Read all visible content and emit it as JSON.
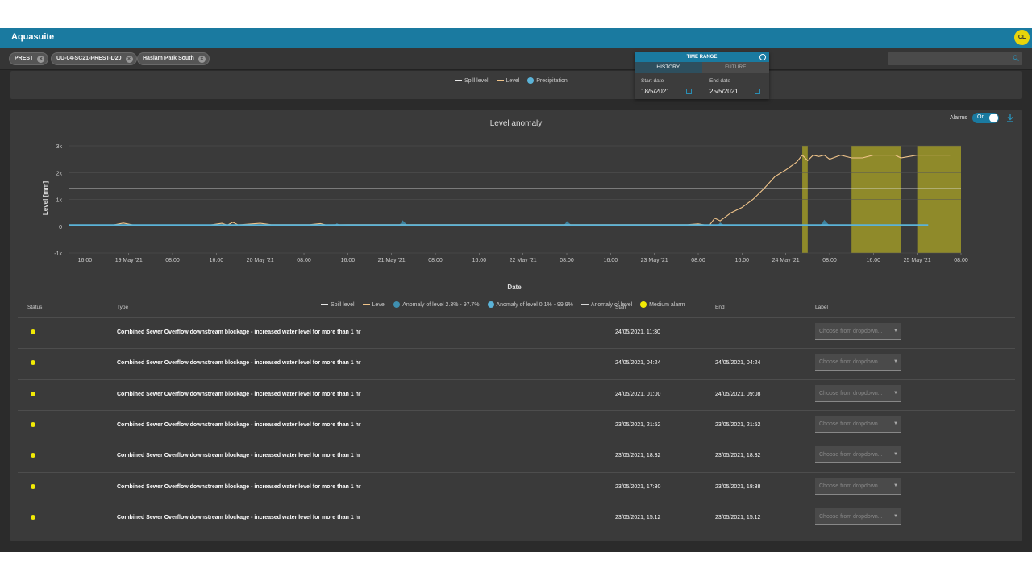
{
  "app": {
    "title": "Aquasuite",
    "avatar": "CL"
  },
  "filters": [
    {
      "label": "PREST",
      "remove": "×"
    },
    {
      "label": "UU-04-SC21-PREST-D20",
      "remove": "×"
    },
    {
      "label": "Haslam Park South",
      "remove": "×"
    }
  ],
  "search": {
    "placeholder": "",
    "icon": "search-icon"
  },
  "top_legend": [
    {
      "label": "Spill level",
      "color": "#e8e8e8",
      "kind": "line"
    },
    {
      "label": "Level",
      "color": "#f0c48a",
      "kind": "line"
    },
    {
      "label": "Precipitation",
      "color": "#5bb3d8",
      "kind": "dot"
    }
  ],
  "time_range": {
    "title": "TIME RANGE",
    "tabs": [
      "HISTORY",
      "FUTURE"
    ],
    "active_tab": "HISTORY",
    "start_label": "Start date",
    "start_value": "18/5/2021",
    "end_label": "End date",
    "end_value": "25/5/2021"
  },
  "alarms": {
    "label": "Alarms",
    "toggle_text": "On",
    "enabled": true
  },
  "chart_data": {
    "type": "line",
    "title": "Level anomaly",
    "xlabel": "Date",
    "ylabel": "Level [mm]",
    "ylim": [
      -1000,
      3000
    ],
    "yticks": [
      "3k",
      "2k",
      "1k",
      "0",
      "-1k"
    ],
    "xlim": [
      "2021-05-18 13:00",
      "2021-05-25 08:00"
    ],
    "xticks": [
      {
        "t": "2021-05-18 16:00",
        "label": "16:00"
      },
      {
        "t": "2021-05-19 00:00",
        "label": "19 May '21"
      },
      {
        "t": "2021-05-19 08:00",
        "label": "08:00"
      },
      {
        "t": "2021-05-19 16:00",
        "label": "16:00"
      },
      {
        "t": "2021-05-20 00:00",
        "label": "20 May '21"
      },
      {
        "t": "2021-05-20 08:00",
        "label": "08:00"
      },
      {
        "t": "2021-05-20 16:00",
        "label": "16:00"
      },
      {
        "t": "2021-05-21 00:00",
        "label": "21 May '21"
      },
      {
        "t": "2021-05-21 08:00",
        "label": "08:00"
      },
      {
        "t": "2021-05-21 16:00",
        "label": "16:00"
      },
      {
        "t": "2021-05-22 00:00",
        "label": "22 May '21"
      },
      {
        "t": "2021-05-22 08:00",
        "label": "08:00"
      },
      {
        "t": "2021-05-22 16:00",
        "label": "16:00"
      },
      {
        "t": "2021-05-23 00:00",
        "label": "23 May '21"
      },
      {
        "t": "2021-05-23 08:00",
        "label": "08:00"
      },
      {
        "t": "2021-05-23 16:00",
        "label": "16:00"
      },
      {
        "t": "2021-05-24 00:00",
        "label": "24 May '21"
      },
      {
        "t": "2021-05-24 08:00",
        "label": "08:00"
      },
      {
        "t": "2021-05-24 16:00",
        "label": "16:00"
      },
      {
        "t": "2021-05-25 00:00",
        "label": "25 May '21"
      },
      {
        "t": "2021-05-25 08:00",
        "label": "08:00"
      }
    ],
    "series": [
      {
        "name": "Spill level",
        "color": "#e8e8e8",
        "points": [
          [
            "2021-05-18 13:00",
            1400
          ],
          [
            "2021-05-25 08:00",
            1400
          ]
        ]
      },
      {
        "name": "Level",
        "color": "#f0c48a",
        "points": [
          [
            "2021-05-18 13:00",
            30
          ],
          [
            "2021-05-18 21:00",
            40
          ],
          [
            "2021-05-18 23:00",
            120
          ],
          [
            "2021-05-19 01:00",
            40
          ],
          [
            "2021-05-19 15:00",
            50
          ],
          [
            "2021-05-19 17:00",
            110
          ],
          [
            "2021-05-19 18:00",
            40
          ],
          [
            "2021-05-19 19:00",
            150
          ],
          [
            "2021-05-19 20:00",
            50
          ],
          [
            "2021-05-19 22:00",
            80
          ],
          [
            "2021-05-20 00:00",
            110
          ],
          [
            "2021-05-20 02:00",
            60
          ],
          [
            "2021-05-20 09:00",
            60
          ],
          [
            "2021-05-20 11:00",
            100
          ],
          [
            "2021-05-20 12:00",
            50
          ],
          [
            "2021-05-20 16:00",
            60
          ],
          [
            "2021-05-23 06:00",
            60
          ],
          [
            "2021-05-23 08:00",
            90
          ],
          [
            "2021-05-23 10:00",
            20
          ],
          [
            "2021-05-23 11:00",
            300
          ],
          [
            "2021-05-23 12:00",
            200
          ],
          [
            "2021-05-23 14:00",
            500
          ],
          [
            "2021-05-23 16:00",
            700
          ],
          [
            "2021-05-23 18:00",
            1000
          ],
          [
            "2021-05-23 20:00",
            1400
          ],
          [
            "2021-05-23 22:00",
            1850
          ],
          [
            "2021-05-24 00:00",
            2100
          ],
          [
            "2021-05-24 02:00",
            2400
          ],
          [
            "2021-05-24 03:00",
            2650
          ],
          [
            "2021-05-24 04:00",
            2450
          ],
          [
            "2021-05-24 05:00",
            2650
          ],
          [
            "2021-05-24 06:00",
            2600
          ],
          [
            "2021-05-24 07:00",
            2650
          ],
          [
            "2021-05-24 08:00",
            2500
          ],
          [
            "2021-05-24 10:00",
            2650
          ],
          [
            "2021-05-24 12:00",
            2550
          ],
          [
            "2021-05-24 14:00",
            2550
          ],
          [
            "2021-05-24 16:00",
            2650
          ],
          [
            "2021-05-24 20:00",
            2650
          ],
          [
            "2021-05-24 21:00",
            2550
          ],
          [
            "2021-05-25 00:00",
            2650
          ],
          [
            "2021-05-25 06:00",
            2650
          ]
        ]
      },
      {
        "name": "Anomaly of level",
        "color": "#5bb3d8",
        "points": [
          [
            "2021-05-18 13:00",
            40
          ],
          [
            "2021-05-25 02:00",
            40
          ]
        ]
      }
    ],
    "precipitation_peaks": [
      {
        "t": "2021-05-19 06:00",
        "v": 60
      },
      {
        "t": "2021-05-20 14:00",
        "v": 110
      },
      {
        "t": "2021-05-21 02:00",
        "v": 220
      },
      {
        "t": "2021-05-22 08:00",
        "v": 190
      },
      {
        "t": "2021-05-23 12:00",
        "v": 140
      },
      {
        "t": "2021-05-24 07:00",
        "v": 240
      }
    ],
    "alarm_bands": [
      {
        "start": "2021-05-24 03:00",
        "end": "2021-05-24 04:00"
      },
      {
        "start": "2021-05-24 12:00",
        "end": "2021-05-24 21:00"
      },
      {
        "start": "2021-05-25 00:00",
        "end": "2021-05-25 08:00"
      }
    ],
    "legend": [
      {
        "label": "Spill level",
        "color": "#e8e8e8",
        "kind": "line"
      },
      {
        "label": "Level",
        "color": "#f0c48a",
        "kind": "line"
      },
      {
        "label": "Anomaly of level 2.3% - 97.7%",
        "color": "#3f8fb0",
        "kind": "dot"
      },
      {
        "label": "Anomaly of level 0.1% - 99.9%",
        "color": "#5bb3d8",
        "kind": "dot"
      },
      {
        "label": "Anomaly of level",
        "color": "#d8d8d8",
        "kind": "line"
      },
      {
        "label": "Medium alarm",
        "color": "#f2ea05",
        "kind": "dot"
      }
    ],
    "alarm_color": "#8f8a2a"
  },
  "table": {
    "columns": [
      "Status",
      "Type",
      "Start",
      "End",
      "Label"
    ],
    "dropdown_placeholder": "Choose from dropdown...",
    "rows": [
      {
        "type": "Combined Sewer Overflow downstream blockage - increased water level for more than 1 hr",
        "start": "24/05/2021, 11:30",
        "end": ""
      },
      {
        "type": "Combined Sewer Overflow downstream blockage - increased water level for more than 1 hr",
        "start": "24/05/2021, 04:24",
        "end": "24/05/2021, 04:24"
      },
      {
        "type": "Combined Sewer Overflow downstream blockage - increased water level for more than 1 hr",
        "start": "24/05/2021, 01:00",
        "end": "24/05/2021, 09:08"
      },
      {
        "type": "Combined Sewer Overflow downstream blockage - increased water level for more than 1 hr",
        "start": "23/05/2021, 21:52",
        "end": "23/05/2021, 21:52"
      },
      {
        "type": "Combined Sewer Overflow downstream blockage - increased water level for more than 1 hr",
        "start": "23/05/2021, 18:32",
        "end": "23/05/2021, 18:32"
      },
      {
        "type": "Combined Sewer Overflow downstream blockage - increased water level for more than 1 hr",
        "start": "23/05/2021, 17:30",
        "end": "23/05/2021, 18:38"
      },
      {
        "type": "Combined Sewer Overflow downstream blockage - increased water level for more than 1 hr",
        "start": "23/05/2021, 15:12",
        "end": "23/05/2021, 15:12"
      }
    ]
  }
}
